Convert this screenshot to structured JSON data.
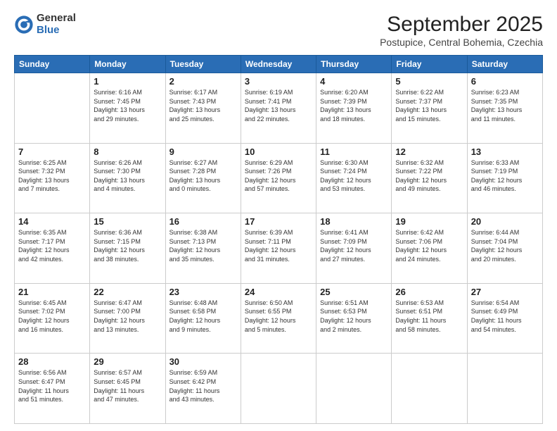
{
  "logo": {
    "general": "General",
    "blue": "Blue"
  },
  "header": {
    "month": "September 2025",
    "location": "Postupice, Central Bohemia, Czechia"
  },
  "weekdays": [
    "Sunday",
    "Monday",
    "Tuesday",
    "Wednesday",
    "Thursday",
    "Friday",
    "Saturday"
  ],
  "weeks": [
    [
      {
        "day": "",
        "info": ""
      },
      {
        "day": "1",
        "info": "Sunrise: 6:16 AM\nSunset: 7:45 PM\nDaylight: 13 hours\nand 29 minutes."
      },
      {
        "day": "2",
        "info": "Sunrise: 6:17 AM\nSunset: 7:43 PM\nDaylight: 13 hours\nand 25 minutes."
      },
      {
        "day": "3",
        "info": "Sunrise: 6:19 AM\nSunset: 7:41 PM\nDaylight: 13 hours\nand 22 minutes."
      },
      {
        "day": "4",
        "info": "Sunrise: 6:20 AM\nSunset: 7:39 PM\nDaylight: 13 hours\nand 18 minutes."
      },
      {
        "day": "5",
        "info": "Sunrise: 6:22 AM\nSunset: 7:37 PM\nDaylight: 13 hours\nand 15 minutes."
      },
      {
        "day": "6",
        "info": "Sunrise: 6:23 AM\nSunset: 7:35 PM\nDaylight: 13 hours\nand 11 minutes."
      }
    ],
    [
      {
        "day": "7",
        "info": "Sunrise: 6:25 AM\nSunset: 7:32 PM\nDaylight: 13 hours\nand 7 minutes."
      },
      {
        "day": "8",
        "info": "Sunrise: 6:26 AM\nSunset: 7:30 PM\nDaylight: 13 hours\nand 4 minutes."
      },
      {
        "day": "9",
        "info": "Sunrise: 6:27 AM\nSunset: 7:28 PM\nDaylight: 13 hours\nand 0 minutes."
      },
      {
        "day": "10",
        "info": "Sunrise: 6:29 AM\nSunset: 7:26 PM\nDaylight: 12 hours\nand 57 minutes."
      },
      {
        "day": "11",
        "info": "Sunrise: 6:30 AM\nSunset: 7:24 PM\nDaylight: 12 hours\nand 53 minutes."
      },
      {
        "day": "12",
        "info": "Sunrise: 6:32 AM\nSunset: 7:22 PM\nDaylight: 12 hours\nand 49 minutes."
      },
      {
        "day": "13",
        "info": "Sunrise: 6:33 AM\nSunset: 7:19 PM\nDaylight: 12 hours\nand 46 minutes."
      }
    ],
    [
      {
        "day": "14",
        "info": "Sunrise: 6:35 AM\nSunset: 7:17 PM\nDaylight: 12 hours\nand 42 minutes."
      },
      {
        "day": "15",
        "info": "Sunrise: 6:36 AM\nSunset: 7:15 PM\nDaylight: 12 hours\nand 38 minutes."
      },
      {
        "day": "16",
        "info": "Sunrise: 6:38 AM\nSunset: 7:13 PM\nDaylight: 12 hours\nand 35 minutes."
      },
      {
        "day": "17",
        "info": "Sunrise: 6:39 AM\nSunset: 7:11 PM\nDaylight: 12 hours\nand 31 minutes."
      },
      {
        "day": "18",
        "info": "Sunrise: 6:41 AM\nSunset: 7:09 PM\nDaylight: 12 hours\nand 27 minutes."
      },
      {
        "day": "19",
        "info": "Sunrise: 6:42 AM\nSunset: 7:06 PM\nDaylight: 12 hours\nand 24 minutes."
      },
      {
        "day": "20",
        "info": "Sunrise: 6:44 AM\nSunset: 7:04 PM\nDaylight: 12 hours\nand 20 minutes."
      }
    ],
    [
      {
        "day": "21",
        "info": "Sunrise: 6:45 AM\nSunset: 7:02 PM\nDaylight: 12 hours\nand 16 minutes."
      },
      {
        "day": "22",
        "info": "Sunrise: 6:47 AM\nSunset: 7:00 PM\nDaylight: 12 hours\nand 13 minutes."
      },
      {
        "day": "23",
        "info": "Sunrise: 6:48 AM\nSunset: 6:58 PM\nDaylight: 12 hours\nand 9 minutes."
      },
      {
        "day": "24",
        "info": "Sunrise: 6:50 AM\nSunset: 6:55 PM\nDaylight: 12 hours\nand 5 minutes."
      },
      {
        "day": "25",
        "info": "Sunrise: 6:51 AM\nSunset: 6:53 PM\nDaylight: 12 hours\nand 2 minutes."
      },
      {
        "day": "26",
        "info": "Sunrise: 6:53 AM\nSunset: 6:51 PM\nDaylight: 11 hours\nand 58 minutes."
      },
      {
        "day": "27",
        "info": "Sunrise: 6:54 AM\nSunset: 6:49 PM\nDaylight: 11 hours\nand 54 minutes."
      }
    ],
    [
      {
        "day": "28",
        "info": "Sunrise: 6:56 AM\nSunset: 6:47 PM\nDaylight: 11 hours\nand 51 minutes."
      },
      {
        "day": "29",
        "info": "Sunrise: 6:57 AM\nSunset: 6:45 PM\nDaylight: 11 hours\nand 47 minutes."
      },
      {
        "day": "30",
        "info": "Sunrise: 6:59 AM\nSunset: 6:42 PM\nDaylight: 11 hours\nand 43 minutes."
      },
      {
        "day": "",
        "info": ""
      },
      {
        "day": "",
        "info": ""
      },
      {
        "day": "",
        "info": ""
      },
      {
        "day": "",
        "info": ""
      }
    ]
  ]
}
